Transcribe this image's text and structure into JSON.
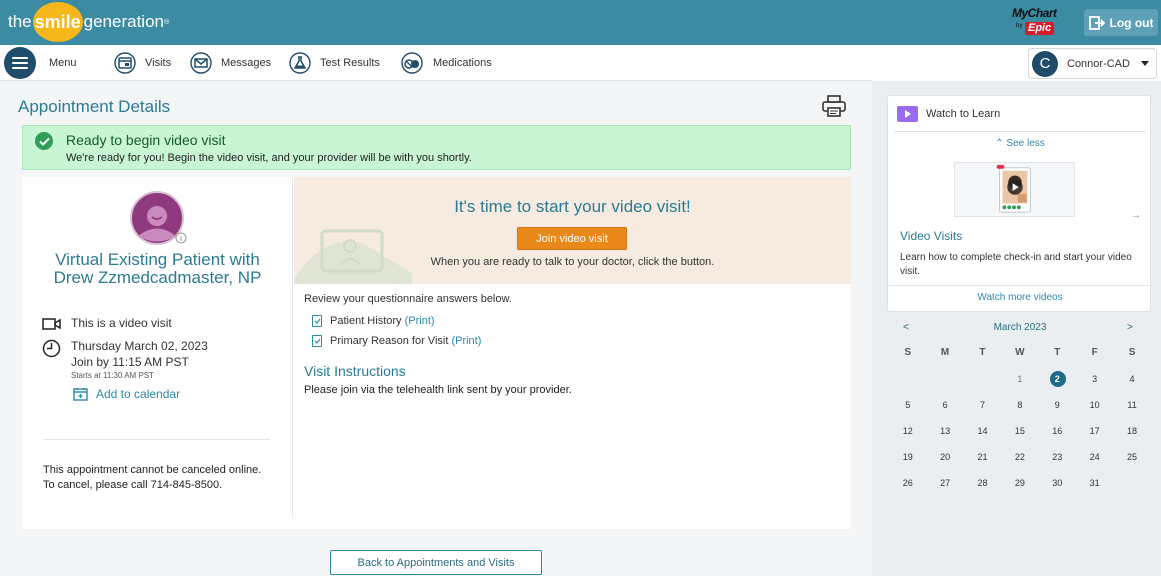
{
  "header": {
    "logo_left": "the",
    "logo_mid": "smile",
    "logo_right": "generation",
    "logo_tm": "®",
    "mychart": "MyChart",
    "mychart_by": "by",
    "epic": "Epic",
    "logout_label": "Log out"
  },
  "nav": {
    "menu": "Menu",
    "visits": "Visits",
    "messages": "Messages",
    "test_results": "Test Results",
    "medications": "Medications",
    "user_initial": "C",
    "user_name": "Connor-CAD"
  },
  "page": {
    "title": "Appointment Details",
    "banner_title": "Ready to begin video visit",
    "banner_msg": "We're ready for you! Begin the video visit, and your provider will be with you shortly."
  },
  "appointment": {
    "visit_name": "Virtual Existing Patient with Drew Zzmedcadmaster, NP",
    "video_visit": "This is a video visit",
    "date": "Thursday March 02, 2023",
    "join_by": "Join by 11:15 AM PST",
    "starts_at": "Starts at 11:30 AM PST",
    "add_calendar": "Add to calendar",
    "cancel_note": "This appointment cannot be canceled online. To cancel, please call 714-845-8500."
  },
  "video": {
    "title": "It's time to start your video visit!",
    "join_button": "Join video visit",
    "sub": "When you are ready to talk to your doctor, click the button."
  },
  "questionnaire": {
    "intro": "Review your questionnaire answers below.",
    "items": [
      {
        "label": "Patient History",
        "print": "(Print)"
      },
      {
        "label": "Primary Reason for Visit",
        "print": "(Print)"
      }
    ]
  },
  "instructions": {
    "title": "Visit Instructions",
    "text": "Please join via the telehealth link sent by your provider."
  },
  "back_button": "Back to Appointments and Visits",
  "sidebar": {
    "watch_title": "Watch to Learn",
    "see_less": "See less",
    "video_title": "Video Visits",
    "video_desc": "Learn how to complete check-in and start your video visit.",
    "watch_more": "Watch more videos"
  },
  "calendar": {
    "prev": "<",
    "month": "March 2023",
    "next": ">",
    "days_of_week": [
      "S",
      "M",
      "T",
      "W",
      "T",
      "F",
      "S"
    ],
    "weeks": [
      [
        "",
        "",
        "",
        "1",
        "2",
        "3",
        "4"
      ],
      [
        "5",
        "6",
        "7",
        "8",
        "9",
        "10",
        "11"
      ],
      [
        "12",
        "13",
        "14",
        "15",
        "16",
        "17",
        "18"
      ],
      [
        "19",
        "20",
        "21",
        "22",
        "23",
        "24",
        "25"
      ],
      [
        "26",
        "27",
        "28",
        "29",
        "30",
        "31",
        ""
      ]
    ],
    "selected_day": "2",
    "accent_color": "#1f6b8a"
  }
}
